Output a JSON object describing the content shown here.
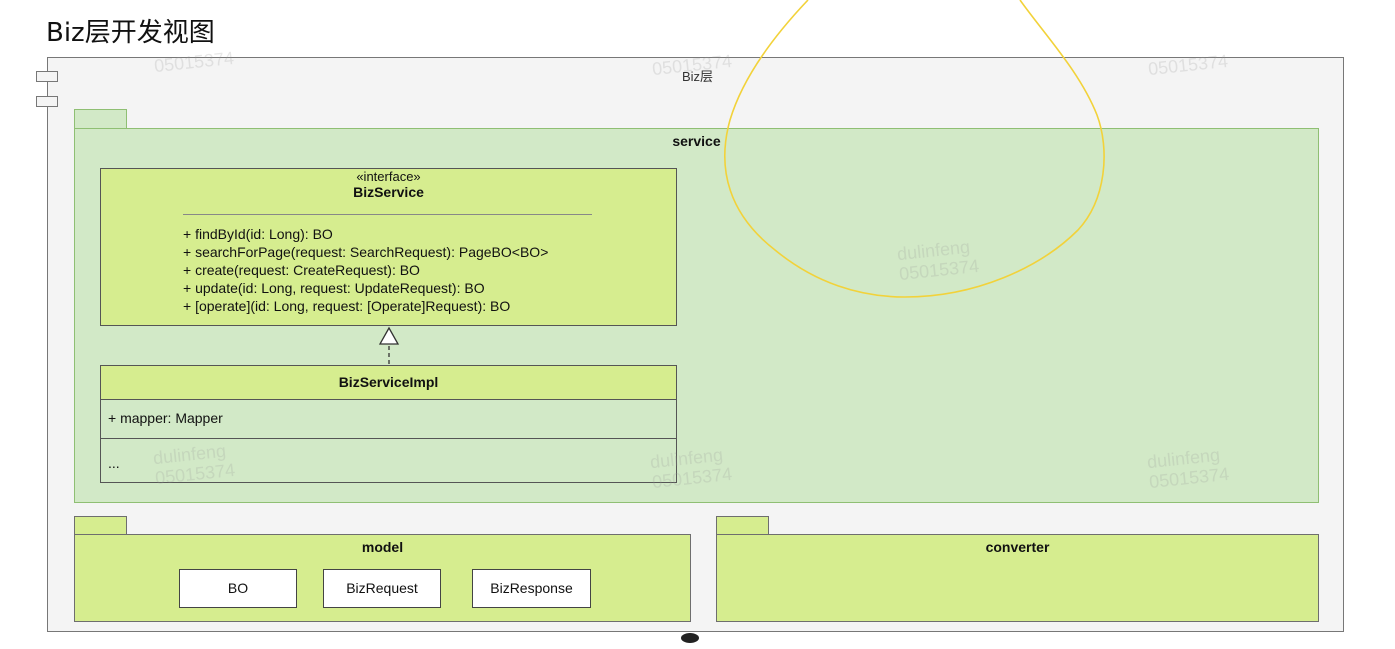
{
  "page_title": "Biz层开发视图",
  "component": {
    "title": "Biz层"
  },
  "packages": {
    "service": {
      "title": "service"
    },
    "model": {
      "title": "model",
      "items": [
        "BO",
        "BizRequest",
        "BizResponse"
      ]
    },
    "converter": {
      "title": "converter"
    }
  },
  "interface_box": {
    "stereotype": "«interface»",
    "name": "BizService",
    "operations": [
      "+ findById(id: Long): BO",
      "+ searchForPage(request: SearchRequest): PageBO<BO>",
      "+ create(request: CreateRequest): BO",
      "+ update(id: Long, request: UpdateRequest): BO",
      "+ [operate](id: Long, request: [Operate]Request): BO"
    ]
  },
  "impl_box": {
    "name": "BizServiceImpl",
    "attribute": "+ mapper: Mapper",
    "ellipsis": "..."
  },
  "watermark": {
    "name": "dulinfeng",
    "id": "05015374"
  },
  "colors": {
    "package_fill": "#d2e9c7",
    "class_fill": "#d6ed8f",
    "annotation_stroke": "#f2d23a"
  }
}
